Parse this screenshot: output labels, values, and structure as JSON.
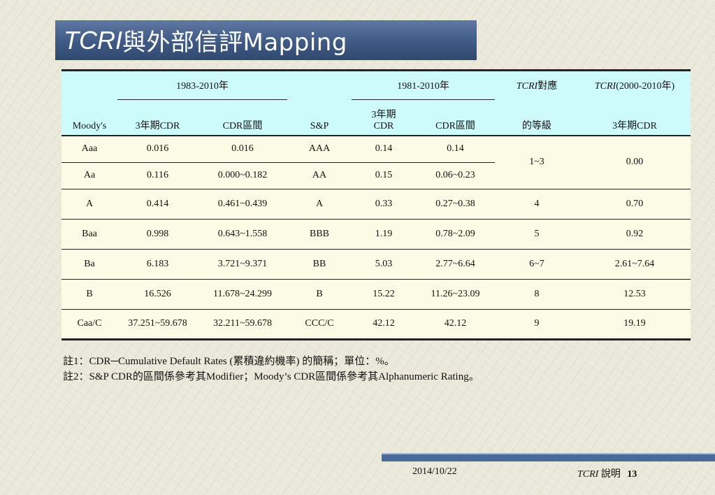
{
  "title": {
    "tcri": "TCRI",
    "rest": "與外部信評Mapping"
  },
  "table": {
    "group_moodys": "1983-2010年",
    "group_sp": "1981-2010年",
    "tcri_map_top_italic": "TCRI",
    "tcri_map_top_rest": "對應",
    "tcri_cdr_top_italic": "TCRI",
    "tcri_cdr_top_rest": "(2000-2010年)",
    "col_moodys": "Moody's",
    "col_moodys_cdr": "3年期CDR",
    "col_moodys_range": "CDR區間",
    "col_sp": "S&P",
    "col_sp_cdr_line1": "3年期",
    "col_sp_cdr_line2": "CDR",
    "col_sp_range": "CDR區間",
    "col_tcri_grade": "的等級",
    "col_tcri_cdr": "3年期CDR",
    "rows": [
      {
        "moodys": "Aaa",
        "m_cdr": "0.016",
        "m_range": "0.016",
        "sp": "AAA",
        "s_cdr": "0.14",
        "s_range": "0.14",
        "grade": "1~3",
        "t_cdr": "0.00"
      },
      {
        "moodys": "Aa",
        "m_cdr": "0.116",
        "m_range": "0.000~0.182",
        "sp": "AA",
        "s_cdr": "0.15",
        "s_range": "0.06~0.23",
        "grade": "",
        "t_cdr": ""
      },
      {
        "moodys": "A",
        "m_cdr": "0.414",
        "m_range": "0.461~0.439",
        "sp": "A",
        "s_cdr": "0.33",
        "s_range": "0.27~0.38",
        "grade": "4",
        "t_cdr": "0.70"
      },
      {
        "moodys": "Baa",
        "m_cdr": "0.998",
        "m_range": "0.643~1.558",
        "sp": "BBB",
        "s_cdr": "1.19",
        "s_range": "0.78~2.09",
        "grade": "5",
        "t_cdr": "0.92"
      },
      {
        "moodys": "Ba",
        "m_cdr": "6.183",
        "m_range": "3.721~9.371",
        "sp": "BB",
        "s_cdr": "5.03",
        "s_range": "2.77~6.64",
        "grade": "6~7",
        "t_cdr": "2.61~7.64"
      },
      {
        "moodys": "B",
        "m_cdr": "16.526",
        "m_range": "11.678~24.299",
        "sp": "B",
        "s_cdr": "15.22",
        "s_range": "11.26~23.09",
        "grade": "8",
        "t_cdr": "12.53"
      },
      {
        "moodys": "Caa/C",
        "m_cdr": "37.251~59.678",
        "m_range": "32.211~59.678",
        "sp": "CCC/C",
        "s_cdr": "42.12",
        "s_range": "42.12",
        "grade": "9",
        "t_cdr": "19.19"
      }
    ]
  },
  "notes": [
    "註1：CDR─Cumulative Default Rates (累積違約機率) 的簡稱；單位：%。",
    "註2：S&P CDR的區間係參考其Modifier；Moody’s CDR區間係參考其Alphanumeric Rating。"
  ],
  "footer": {
    "date": "2014/10/22",
    "brand": "TCRI",
    "label": "說明",
    "page": "13"
  }
}
